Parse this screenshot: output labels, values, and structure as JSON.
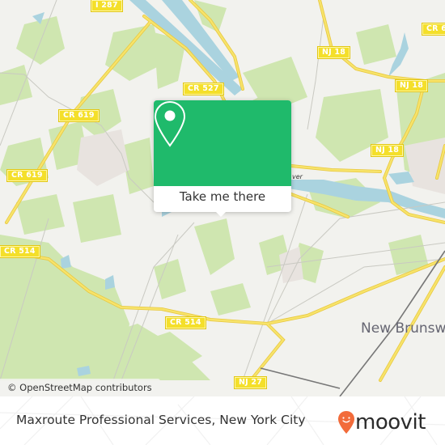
{
  "map": {
    "road_shields": [
      {
        "id": "i287",
        "label": "I 287"
      },
      {
        "id": "cr527",
        "label": "CR 527"
      },
      {
        "id": "cr619a",
        "label": "CR 619"
      },
      {
        "id": "cr619b",
        "label": "CR 619"
      },
      {
        "id": "cr514a",
        "label": "CR 514"
      },
      {
        "id": "cr514b",
        "label": "CR 514"
      },
      {
        "id": "nj18a",
        "label": "NJ 18"
      },
      {
        "id": "nj18b",
        "label": "NJ 18"
      },
      {
        "id": "nj18c",
        "label": "NJ 18"
      },
      {
        "id": "cr6",
        "label": "CR 6"
      },
      {
        "id": "nj27",
        "label": "NJ 27"
      }
    ],
    "city_label": "New Brunsw",
    "river_label": "ver",
    "attribution": "© OpenStreetMap contributors",
    "colors": {
      "land": "#f2f2ee",
      "park": "#cfe6b0",
      "water": "#aad3df",
      "major_road": "#f7e36a",
      "road_casing": "#e8c840",
      "minor_road": "#c9c9c2",
      "rail": "#777777"
    }
  },
  "popup": {
    "icon": "location-pin-icon",
    "button_label": "Take me there",
    "color": "#1fba6b"
  },
  "footer": {
    "title": "Maxroute Professional Services, New York City",
    "brand": "moovit",
    "brand_color": "#f26b3a"
  }
}
